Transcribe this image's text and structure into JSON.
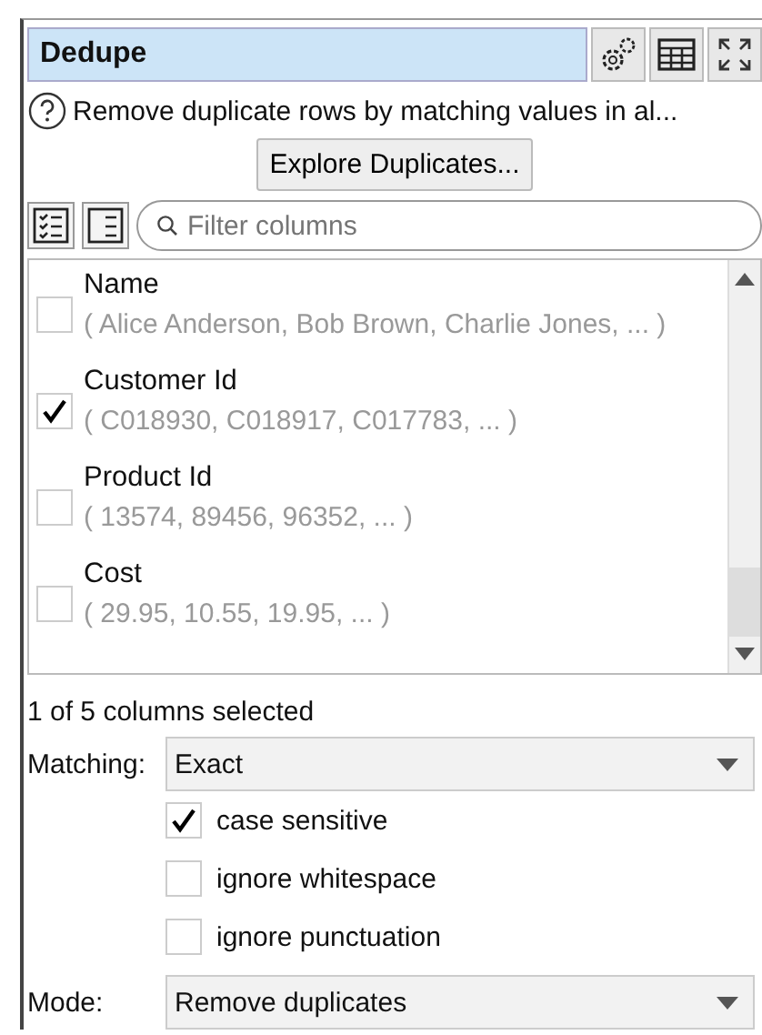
{
  "panel": {
    "title": "Dedupe"
  },
  "description": "Remove duplicate rows by matching values in al...",
  "explore_button": "Explore Duplicates...",
  "filter": {
    "placeholder": "Filter columns"
  },
  "columns": [
    {
      "name": "Name",
      "values": "( Alice Anderson, Bob Brown, Charlie Jones, ... )",
      "checked": false
    },
    {
      "name": "Customer Id",
      "values": "( C018930, C018917, C017783, ... )",
      "checked": true
    },
    {
      "name": "Product Id",
      "values": "( 13574, 89456, 96352, ... )",
      "checked": false
    },
    {
      "name": "Cost",
      "values": "( 29.95, 10.55, 19.95, ... )",
      "checked": false
    }
  ],
  "selection_status": "1 of 5 columns selected",
  "matching": {
    "label": "Matching:",
    "value": "Exact"
  },
  "options": [
    {
      "label": "case sensitive",
      "checked": true
    },
    {
      "label": "ignore whitespace",
      "checked": false
    },
    {
      "label": "ignore punctuation",
      "checked": false
    }
  ],
  "mode": {
    "label": "Mode:",
    "value": "Remove duplicates"
  }
}
